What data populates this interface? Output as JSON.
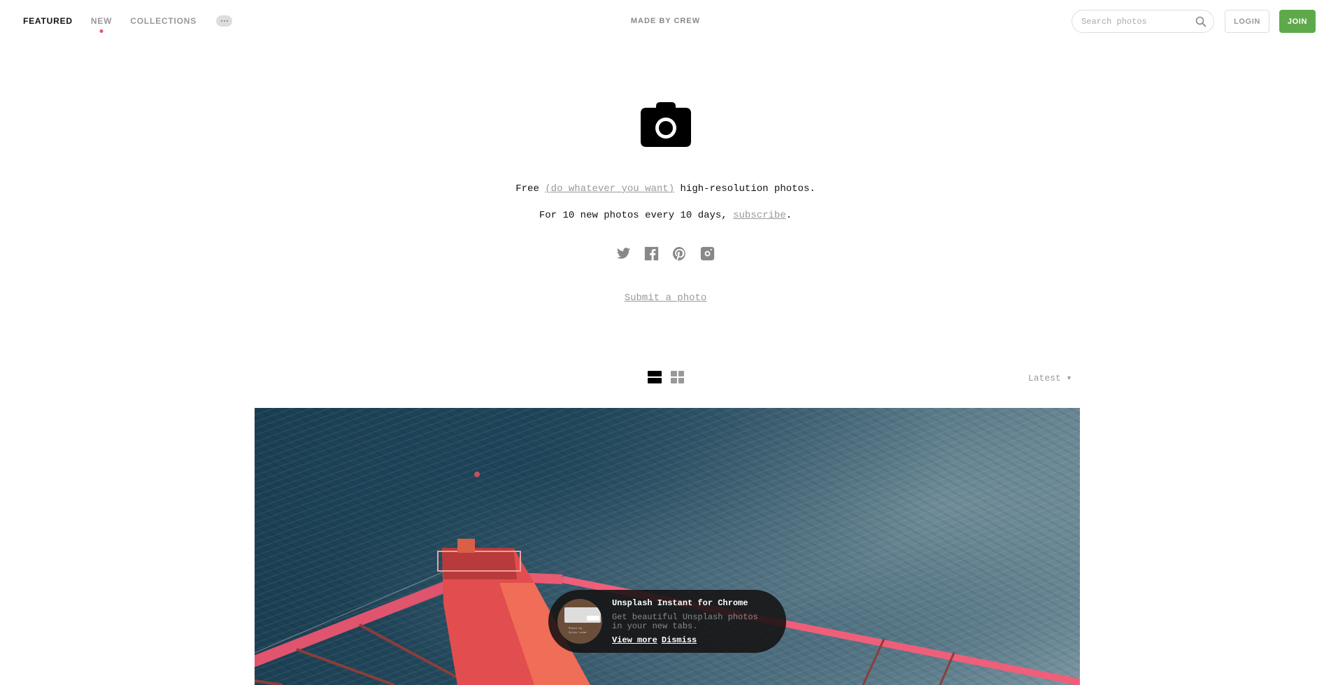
{
  "nav": {
    "items": [
      {
        "label": "FEATURED",
        "active": true
      },
      {
        "label": "NEW",
        "active": false,
        "has_dot": true
      },
      {
        "label": "COLLECTIONS",
        "active": false
      }
    ],
    "more_icon": "ellipsis-icon",
    "center_label": "MADE BY CREW",
    "search": {
      "placeholder": "Search photos",
      "value": "",
      "icon": "search-icon"
    },
    "login_label": "LOGIN",
    "join_label": "JOIN"
  },
  "hero": {
    "icon": "camera-icon",
    "tagline_prefix": "Free ",
    "tagline_link": "(do whatever you want)",
    "tagline_suffix": " high-resolution photos.",
    "sub_prefix": "For 10 new photos every 10 days, ",
    "sub_link": "subscribe",
    "sub_suffix": ".",
    "social": [
      "twitter-icon",
      "facebook-icon",
      "pinterest-icon",
      "instagram-icon"
    ],
    "submit_label": "Submit a photo"
  },
  "toolbar": {
    "views": [
      "list-view-icon",
      "grid-view-icon"
    ],
    "active_view": "list",
    "sort_label": "Latest ▾"
  },
  "photo": {
    "subject": "Aerial view of red bridge tower over ocean"
  },
  "promo": {
    "title": "Unsplash Instant for Chrome",
    "description": "Get beautiful Unsplash photos in your new tabs.",
    "thumb_caption_1": "Photo by",
    "thumb_caption_2": "Dylan Luder",
    "view_more": "View more",
    "dismiss": "Dismiss"
  },
  "colors": {
    "join_green": "#5eaa4a",
    "new_dot": "#e25864",
    "link_grey": "#999999"
  }
}
